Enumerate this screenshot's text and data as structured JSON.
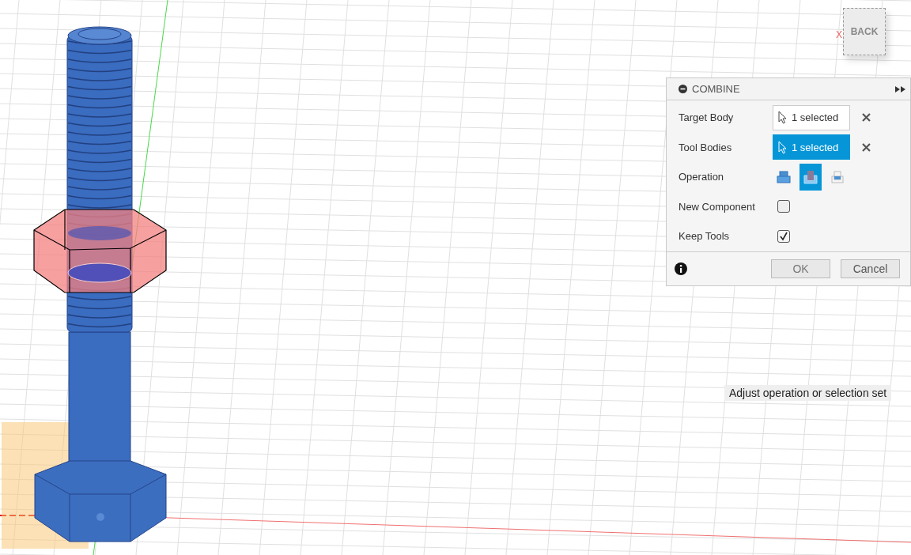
{
  "viewcube": {
    "face_label": "BACK",
    "axis_label": "X"
  },
  "dialog": {
    "title": "COMBINE",
    "rows": [
      {
        "kind": "selection",
        "label": "Target Body",
        "value": "1 selected",
        "active": false
      },
      {
        "kind": "selection",
        "label": "Tool Bodies",
        "value": "1 selected",
        "active": true
      },
      {
        "kind": "operation",
        "label": "Operation",
        "options": [
          {
            "kind": "join",
            "selected": false
          },
          {
            "kind": "cut",
            "selected": true
          },
          {
            "kind": "intersect",
            "selected": false
          }
        ]
      },
      {
        "kind": "checkbox",
        "label": "New Component",
        "checked": false
      },
      {
        "kind": "checkbox",
        "label": "Keep Tools",
        "checked": true
      }
    ],
    "buttons": [
      "OK",
      "Cancel"
    ]
  },
  "tooltip": "Adjust operation or selection set"
}
